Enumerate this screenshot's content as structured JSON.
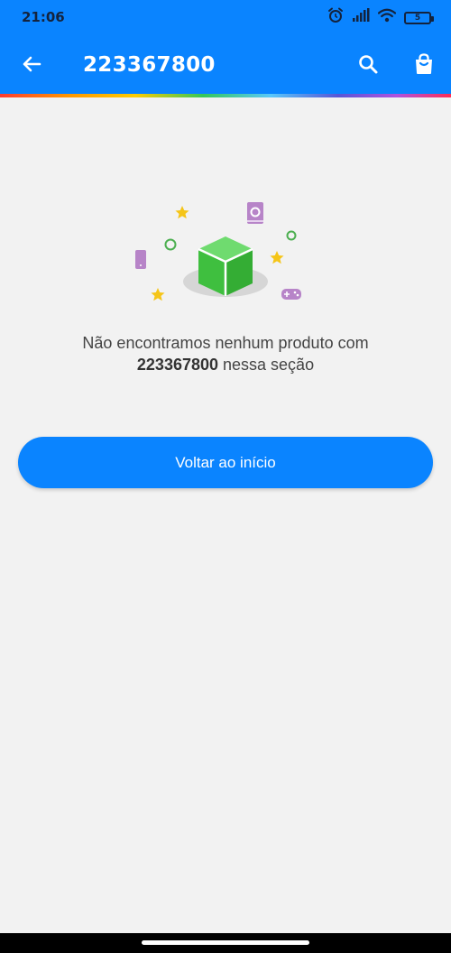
{
  "status_bar": {
    "time": "21:06",
    "battery_level": "5",
    "icons": [
      "alarm-icon",
      "signal-icon",
      "wifi-icon",
      "battery-icon"
    ]
  },
  "app_bar": {
    "title": "223367800",
    "icons": [
      "back-arrow-icon",
      "search-icon",
      "shopping-bag-icon"
    ]
  },
  "empty_state": {
    "illustration_icon": "empty-box-icon",
    "message_prefix": "Não encontramos nenhum produto com",
    "query": "223367800",
    "message_suffix": " nessa seção"
  },
  "actions": {
    "back_home_label": "Voltar ao início"
  },
  "colors": {
    "primary": "#0a84ff",
    "background": "#f2f2f2",
    "cube_green": "#3fbf3f",
    "star_yellow": "#f5c518",
    "accent_purple": "#b784c8"
  }
}
